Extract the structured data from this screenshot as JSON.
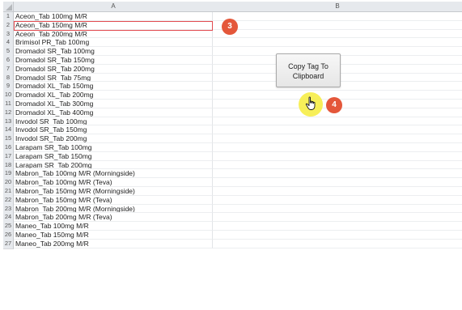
{
  "sheet": {
    "columns": [
      "A",
      "B"
    ],
    "rows": [
      {
        "num": "1",
        "a": "Aceon_Tab 100mg M/R"
      },
      {
        "num": "2",
        "a": "Aceon_Tab 150mg M/R"
      },
      {
        "num": "3",
        "a": "Aceon_Tab 200mg M/R"
      },
      {
        "num": "4",
        "a": "Brimisol PR_Tab 100mg"
      },
      {
        "num": "5",
        "a": "Dromadol SR_Tab 100mg"
      },
      {
        "num": "6",
        "a": "Dromadol SR_Tab 150mg"
      },
      {
        "num": "7",
        "a": "Dromadol SR_Tab 200mg"
      },
      {
        "num": "8",
        "a": "Dromadol SR_Tab 75mg"
      },
      {
        "num": "9",
        "a": "Dromadol XL_Tab 150mg"
      },
      {
        "num": "10",
        "a": "Dromadol XL_Tab 200mg"
      },
      {
        "num": "11",
        "a": "Dromadol XL_Tab 300mg"
      },
      {
        "num": "12",
        "a": "Dromadol XL_Tab 400mg"
      },
      {
        "num": "13",
        "a": "Invodol SR_Tab 100mg"
      },
      {
        "num": "14",
        "a": "Invodol SR_Tab 150mg"
      },
      {
        "num": "15",
        "a": "Invodol SR_Tab 200mg"
      },
      {
        "num": "16",
        "a": "Larapam SR_Tab 100mg"
      },
      {
        "num": "17",
        "a": "Larapam SR_Tab 150mg"
      },
      {
        "num": "18",
        "a": "Larapam SR_Tab 200mg"
      },
      {
        "num": "19",
        "a": "Mabron_Tab 100mg M/R (Morningside)"
      },
      {
        "num": "20",
        "a": "Mabron_Tab 100mg M/R (Teva)"
      },
      {
        "num": "21",
        "a": "Mabron_Tab 150mg M/R (Morningside)"
      },
      {
        "num": "22",
        "a": "Mabron_Tab 150mg M/R (Teva)"
      },
      {
        "num": "23",
        "a": "Mabron_Tab 200mg M/R (Morningside)"
      },
      {
        "num": "24",
        "a": "Mabron_Tab 200mg M/R (Teva)"
      },
      {
        "num": "25",
        "a": "Maneo_Tab 100mg M/R"
      },
      {
        "num": "26",
        "a": "Maneo_Tab 150mg M/R"
      },
      {
        "num": "27",
        "a": "Maneo_Tab 200mg M/R"
      }
    ]
  },
  "annotations": {
    "step3": "3",
    "step4": "4",
    "badge_color": "#e4573a",
    "highlight_color": "#e24b50"
  },
  "copy_button": {
    "line1": "Copy Tag To",
    "line2": "Clipboard"
  },
  "icons": {
    "cursor": "hand-pointer-icon",
    "corner": "select-all-triangle-icon"
  }
}
